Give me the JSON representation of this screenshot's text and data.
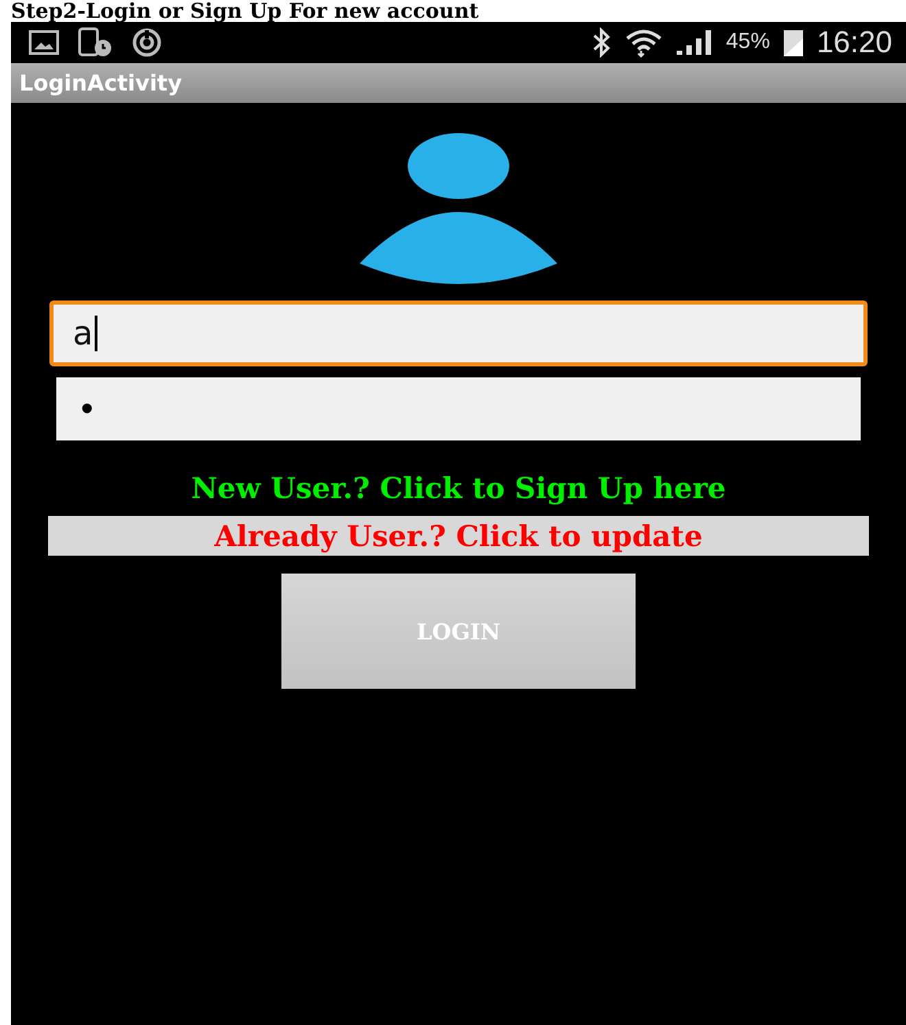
{
  "caption": "Step2-Login or Sign Up For new account",
  "status_bar": {
    "battery": "45%",
    "time": "16:20"
  },
  "window": {
    "title": "LoginActivity"
  },
  "fields": [
    {
      "kind": "text",
      "value": "a",
      "focused": true
    },
    {
      "kind": "password",
      "value": "•",
      "focused": false
    }
  ],
  "links": [
    {
      "kind": "signup",
      "label": "New User.? Click to Sign Up here"
    },
    {
      "kind": "update",
      "label": "Already User.? Click to update"
    }
  ],
  "login_button": "LOGIN"
}
